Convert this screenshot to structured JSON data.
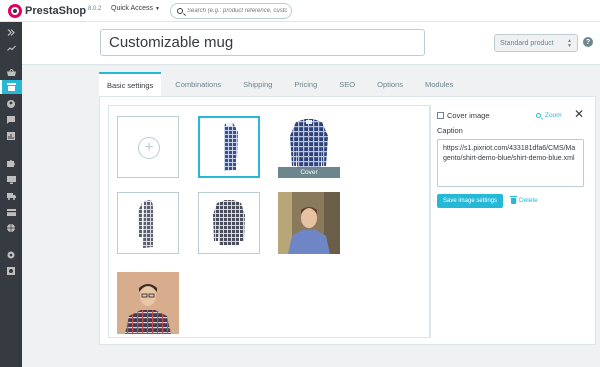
{
  "topbar": {
    "brand": "PrestaShop",
    "version": "8.0.2",
    "quick_access": "Quick Access",
    "search_placeholder": "Search (e.g.: product reference, custon"
  },
  "sidebar": {
    "items": [
      {
        "icon": "chevrons-right-icon"
      },
      {
        "icon": "trending-up-icon"
      },
      {
        "icon": "shopping-basket-icon"
      },
      {
        "icon": "store-icon",
        "active": true
      },
      {
        "icon": "account-circle-icon"
      },
      {
        "icon": "chat-icon"
      },
      {
        "icon": "bar-chart-icon"
      },
      {
        "icon": "extension-icon"
      },
      {
        "icon": "desktop-icon"
      },
      {
        "icon": "truck-icon"
      },
      {
        "icon": "credit-card-icon"
      },
      {
        "icon": "globe-icon"
      },
      {
        "icon": "settings-icon"
      },
      {
        "icon": "settings-applications-icon"
      }
    ]
  },
  "header": {
    "product_name": "Customizable mug",
    "product_type": "Standard product",
    "help_label": "?"
  },
  "tabs": [
    {
      "label": "Basic settings",
      "active": true
    },
    {
      "label": "Combinations"
    },
    {
      "label": "Shipping"
    },
    {
      "label": "Pricing"
    },
    {
      "label": "SEO"
    },
    {
      "label": "Options"
    },
    {
      "label": "Modules"
    }
  ],
  "images": {
    "cover_label": "Cover"
  },
  "panel": {
    "cover_image_label": "Cover image",
    "zoom_label": "Zoom",
    "caption_label": "Caption",
    "caption_value": "https://s1.pixriot.com/433181dfa6/CMS/Magento/shirt-demo-blue/shirt-demo-blue.xml",
    "save_label": "Save image settings",
    "delete_label": "Delete"
  },
  "colors": {
    "accent": "#25b9d7",
    "sidebar_bg": "#363a41",
    "brand": "#df0067"
  }
}
